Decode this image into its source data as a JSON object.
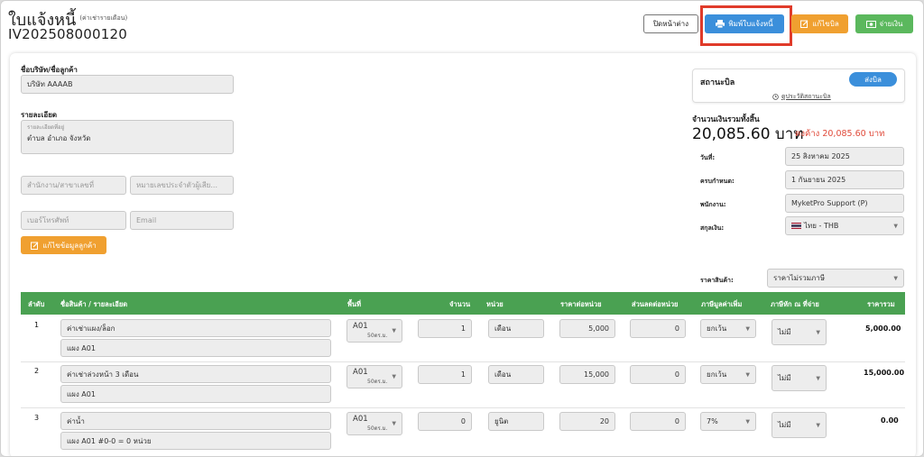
{
  "header": {
    "title": "ใบแจ้งหนี้",
    "title_note": "(ค่าเช่ารายเดือน)",
    "invoice_no": "IV202508000120"
  },
  "toolbar": {
    "close_label": "ปิดหน้าต่าง",
    "print_label": "พิมพ์ใบแจ้งหนี้",
    "edit_label": "แก้ไขบิล",
    "pay_label": "จ่ายเงิน"
  },
  "customer": {
    "company_label": "ชื่อบริษัท/ชื่อลูกค้า",
    "company_value": "บริษัท AAAAB",
    "detail_label": "รายละเอียด",
    "address_hint": "รายละเอียดที่อยู่",
    "address_value": "ตำบล อำเภอ จังหวัด",
    "branch_placeholder": "สำนักงาน/สาขาเลขที่",
    "taxid_placeholder": "หมายเลขประจำตัวผู้เสีย...",
    "phone_placeholder": "เบอร์โทรศัพท์",
    "email_placeholder": "Email",
    "edit_customer_label": "แก้ไขข้อมูลลูกค้า"
  },
  "status": {
    "label": "สถานะบิล",
    "value": "ส่งบิล",
    "history_link": "ดูประวัติสถานะบิล"
  },
  "summary": {
    "total_label": "จำนวนเงินรวมทั้งสิ้น",
    "total_value": "20,085.60 บาท",
    "outstanding": "คงค้าง 20,085.60 บาท"
  },
  "meta": {
    "date_label": "วันที่:",
    "date_value": "25 สิงหาคม 2025",
    "due_label": "ครบกำหนด:",
    "due_value": "1 กันยายน 2025",
    "staff_label": "พนักงาน:",
    "staff_value": "MyketPro Support (P)",
    "currency_label": "สกุลเงิน:",
    "currency_value": "ไทย - THB",
    "price_label": "ราคาสินค้า:",
    "price_value": "ราคาไม่รวมภาษี"
  },
  "table": {
    "columns": [
      "ลำดับ",
      "ชื่อสินค้า / รายละเอียด",
      "พื้นที่",
      "จำนวน",
      "หน่วย",
      "ราคาต่อหน่วย",
      "ส่วนลดต่อหน่วย",
      "ภาษีมูลค่าเพิ่ม",
      "ภาษีหัก ณ ที่จ่าย",
      "ราคารวม"
    ],
    "rows": [
      {
        "no": "1",
        "name": "ค่าเช่าแผง/ล็อก",
        "detail": "แผง A01",
        "area": "A01",
        "area_sub": "50ตร.ม.",
        "qty": "1",
        "unit": "เดือน",
        "price": "5,000",
        "discount": "0",
        "vat": "ยกเว้น",
        "wht": "ไม่มี",
        "total": "5,000.00"
      },
      {
        "no": "2",
        "name": "ค่าเช่าล่วงหน้า 3 เดือน",
        "detail": "แผง A01",
        "area": "A01",
        "area_sub": "50ตร.ม.",
        "qty": "1",
        "unit": "เดือน",
        "price": "15,000",
        "discount": "0",
        "vat": "ยกเว้น",
        "wht": "ไม่มี",
        "total": "15,000.00"
      },
      {
        "no": "3",
        "name": "ค่าน้ำ",
        "detail": "แผง A01 #0-0 = 0 หน่วย",
        "area": "A01",
        "area_sub": "50ตร.ม.",
        "qty": "0",
        "unit": "ยูนิต",
        "price": "20",
        "discount": "0",
        "vat": "7%",
        "wht": "ไม่มี",
        "total": "0.00"
      }
    ]
  },
  "colors": {
    "header_green": "#4aa152",
    "print_blue": "#3b8fdb",
    "edit_orange": "#f0a030",
    "pay_green": "#5bb85d",
    "highlight_red": "#e03b2a",
    "outstanding_red": "#e04a3a"
  }
}
